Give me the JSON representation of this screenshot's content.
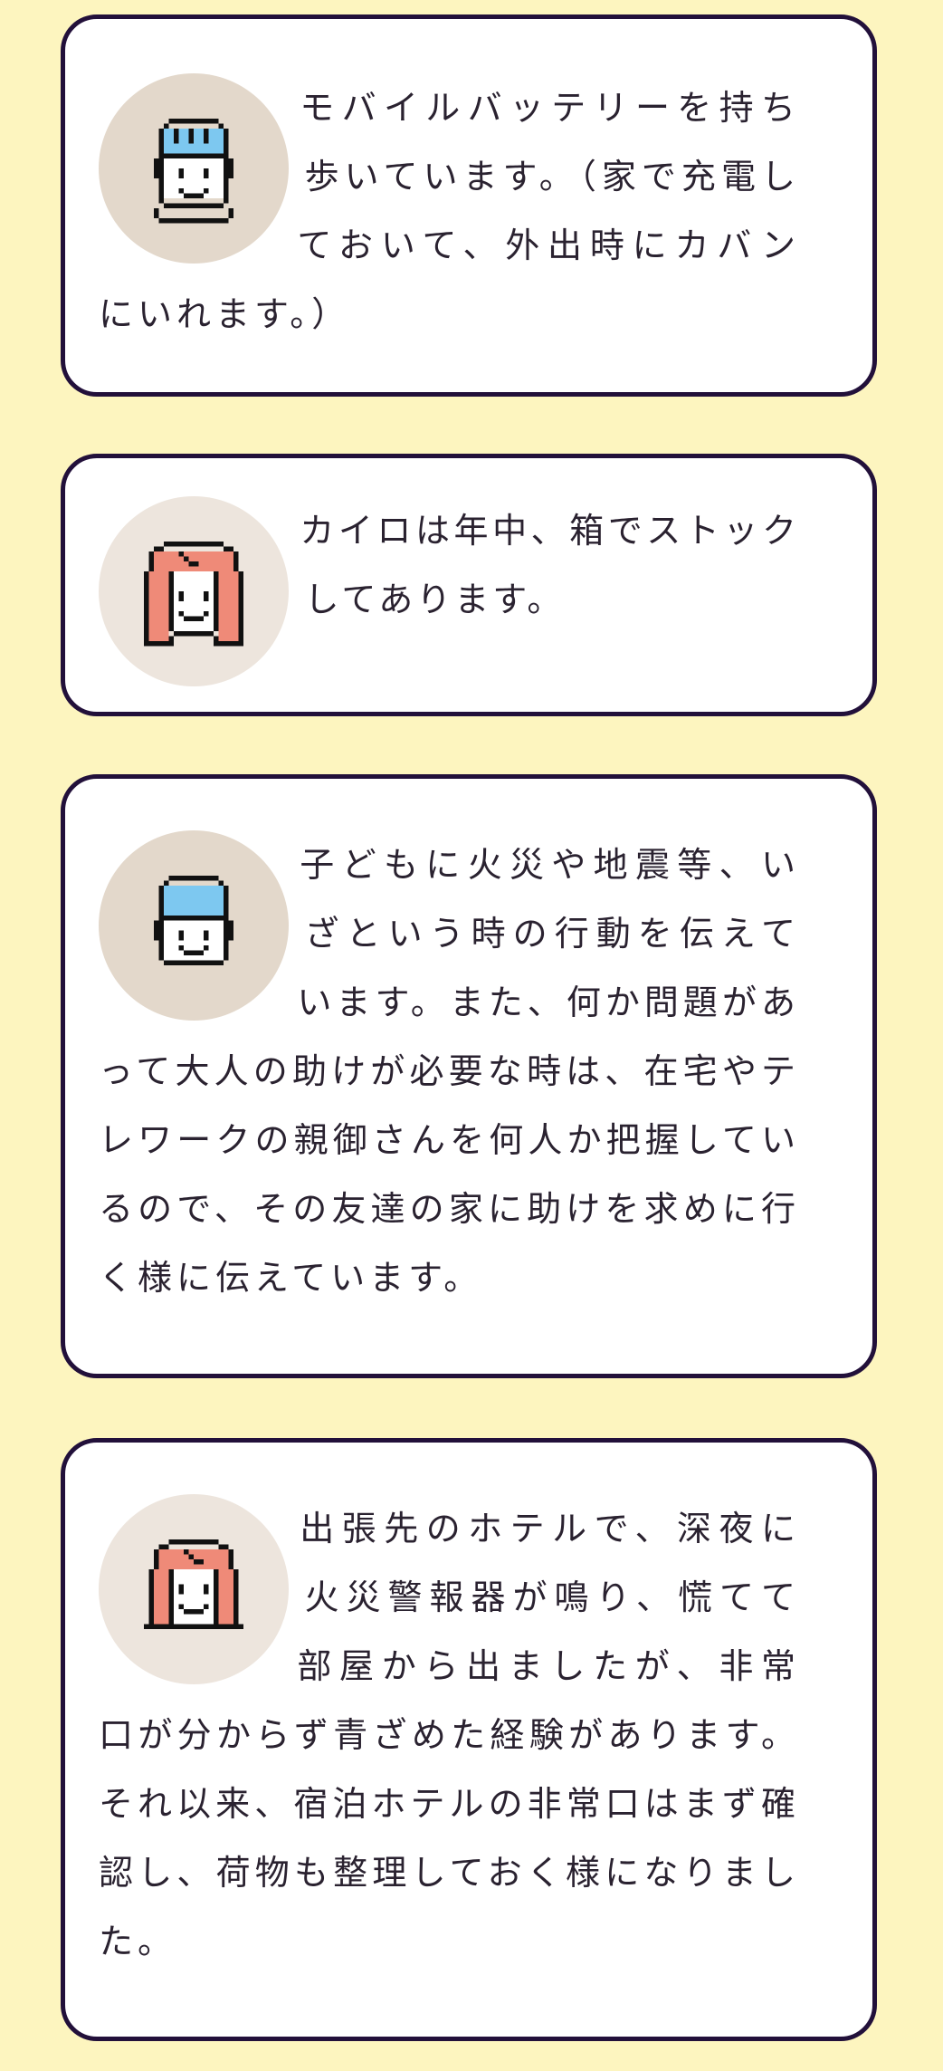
{
  "colors": {
    "background": "#fdf5bf",
    "card_border": "#22103a",
    "avatar_bg_dark": "#e3d8cb",
    "avatar_bg_light": "#ede5dd",
    "hair_blue": "#7dc8f0",
    "hair_pink": "#ef8a78"
  },
  "comments": [
    {
      "avatar": "blue-hair-boy-icon",
      "text": "モバイルバッテリーを持ち歩いています。（家で充電しておいて、外出時にカバンにいれます。）"
    },
    {
      "avatar": "pink-long-hair-woman-icon",
      "text": "カイロは年中、箱でストックしてあります。"
    },
    {
      "avatar": "blue-hair-boy-icon",
      "text": "子どもに火災や地震等、いざという時の行動を伝えています。また、何か問題があって大人の助けが必要な時は、在宅やテレワークの親御さんを何人か把握しているので、その友達の家に助けを求めに行く様に伝えています。"
    },
    {
      "avatar": "pink-short-hair-woman-icon",
      "text": "出張先のホテルで、深夜に火災警報器が鳴り、慌てて部屋から出ましたが、非常口が分からず青ざめた経験があります。それ以来、宿泊ホテルの非常口はまず確認し、荷物も整理しておく様になりました。"
    }
  ]
}
